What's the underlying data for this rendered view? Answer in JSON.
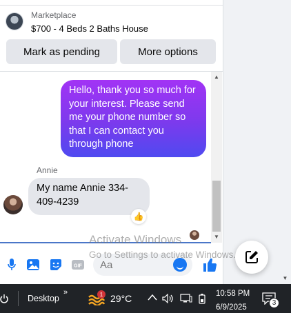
{
  "listing": {
    "kicker": "Marketplace",
    "title": "$700 - 4 Beds 2 Baths House"
  },
  "actions": {
    "mark_pending": "Mark as pending",
    "more_options": "More options"
  },
  "messages": {
    "outgoing_text": "Hello, thank you so much for your interest. Please send me your phone number so that I can contact you through phone",
    "sender_name": "Annie",
    "incoming_text": "My name Annie 334-409-4239",
    "reaction": "👍"
  },
  "composer": {
    "placeholder": "Aa"
  },
  "watermark": {
    "title": "Activate Windows",
    "subtitle": "Go to Settings to activate Windows."
  },
  "taskbar": {
    "desktop_label": "Desktop",
    "chevron": "»",
    "weather_badge": "1",
    "temperature": "29°C",
    "time": "10:58 PM",
    "date": "6/9/2025",
    "notification_count": "3"
  },
  "colors": {
    "accent": "#1877f2",
    "outgoing_gradient_start": "#a233f5",
    "outgoing_gradient_end": "#4f4af0",
    "incoming_bubble": "#e4e6eb"
  }
}
